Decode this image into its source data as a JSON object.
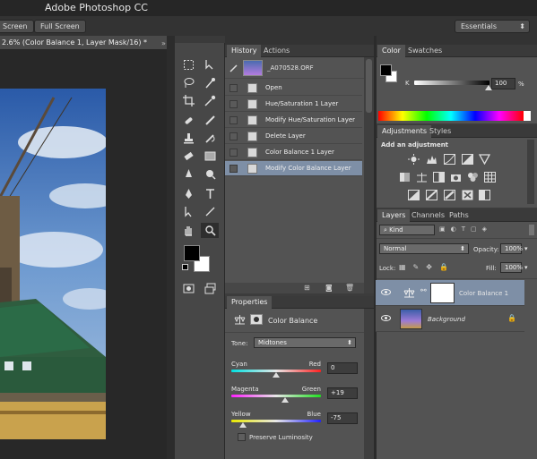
{
  "app": {
    "title": "Adobe Photoshop CC",
    "workspace": "Essentials"
  },
  "options": {
    "screen_label": "Screen",
    "fullscreen_label": "Full Screen"
  },
  "document": {
    "tab_title": "2.6% (Color Balance 1, Layer Mask/16) *"
  },
  "history": {
    "tab_history": "History",
    "tab_actions": "Actions",
    "snapshot_name": "_A070528.ORF",
    "items": [
      "Open",
      "Hue/Saturation 1 Layer",
      "Modify Hue/Saturation Layer",
      "Delete Layer",
      "Color Balance 1 Layer",
      "Modify Color Balance Layer"
    ],
    "selected_index": 5
  },
  "color": {
    "tab_color": "Color",
    "tab_swatches": "Swatches",
    "k_label": "K",
    "k_value": "100",
    "k_unit": "%",
    "foreground": "#000000",
    "background": "#ffffff"
  },
  "adjustments": {
    "tab_adjustments": "Adjustments",
    "tab_styles": "Styles",
    "heading": "Add an adjustment"
  },
  "layers": {
    "tab_layers": "Layers",
    "tab_channels": "Channels",
    "tab_paths": "Paths",
    "filter_kind": "Kind",
    "blend_mode": "Normal",
    "opacity_label": "Opacity:",
    "opacity_value": "100%",
    "lock_label": "Lock:",
    "fill_label": "Fill:",
    "fill_value": "100%",
    "items": [
      {
        "name": "Color Balance 1",
        "selected": true
      },
      {
        "name": "Background",
        "selected": false
      }
    ]
  },
  "properties": {
    "tab": "Properties",
    "title": "Color Balance",
    "tone_label": "Tone:",
    "tone_value": "Midtones",
    "sliders": [
      {
        "left": "Cyan",
        "right": "Red",
        "value": "0",
        "level": 0
      },
      {
        "left": "Magenta",
        "right": "Green",
        "value": "+19",
        "level": 19
      },
      {
        "left": "Yellow",
        "right": "Blue",
        "value": "-75",
        "level": -75
      }
    ],
    "preserve_label": "Preserve Luminosity"
  },
  "colors": {
    "selection": "#7e8fa6",
    "panel": "#535353",
    "dark": "#282828"
  }
}
